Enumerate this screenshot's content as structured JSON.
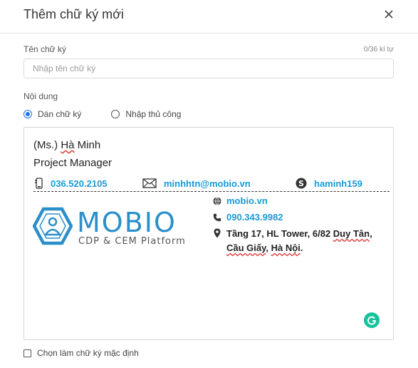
{
  "dialog": {
    "title": "Thêm chữ ký mới",
    "close_icon": "close-icon"
  },
  "name_field": {
    "label": "Tên chữ ký",
    "counter": "0/36 kí tự",
    "placeholder": "Nhập tên chữ ký",
    "value": ""
  },
  "content": {
    "label": "Nội dung",
    "options": [
      {
        "label": "Dán chữ ký",
        "checked": true
      },
      {
        "label": "Nhập thủ công",
        "checked": false
      }
    ]
  },
  "signature": {
    "name_prefix": "(Ms.) ",
    "name_first": "Hà",
    "name_last": " Minh",
    "role": "Project Manager",
    "phone": "036.520.2105",
    "email": "minhhtn@mobio.vn",
    "skype": "haminh159",
    "logo_text": "MOBIO",
    "logo_sub": "CDP & CEM Platform",
    "website": "mobio.vn",
    "hotline": "090.343.9982",
    "address_line1_a": "Tầng 17, HL Tower, 6/82 ",
    "address_line1_b": "Duy Tân",
    "address_line1_c": ",",
    "address_line2_a": "Cầu Giấy",
    "address_line2_b": ", ",
    "address_line2_c": "Hà Nội",
    "address_line2_d": ".",
    "accent_color": "#1a9ad6"
  },
  "default_checkbox": {
    "label": "Chọn làm chữ ký mặc định",
    "checked": false
  }
}
